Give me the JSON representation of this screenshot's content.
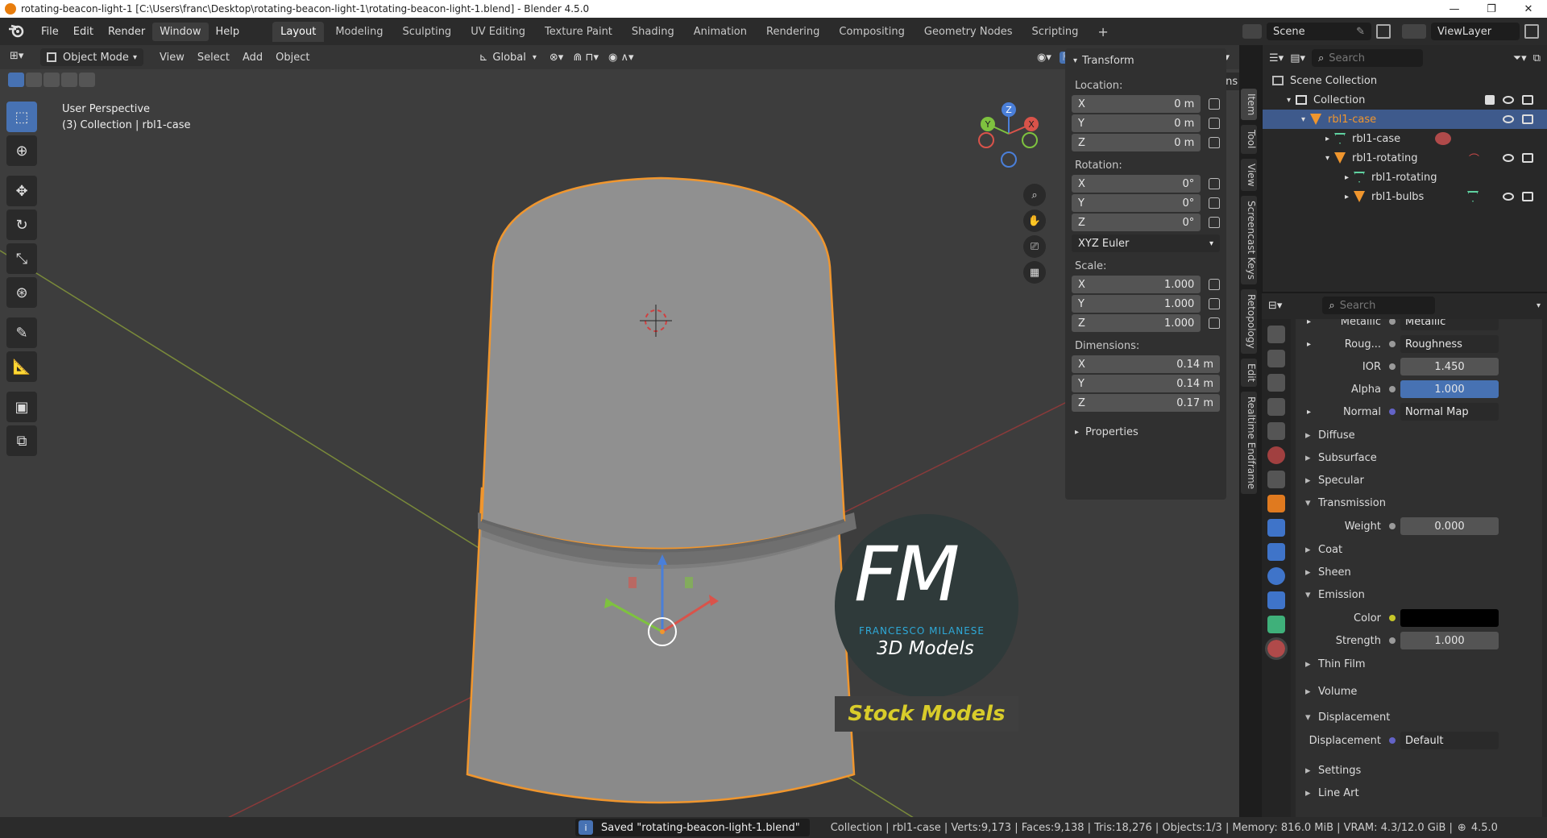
{
  "titlebar": {
    "text": "rotating-beacon-light-1 [C:\\Users\\franc\\Desktop\\rotating-beacon-light-1\\rotating-beacon-light-1.blend] - Blender 4.5.0",
    "minimize": "—",
    "restore": "❐",
    "close": "✕"
  },
  "menu": {
    "file": "File",
    "edit": "Edit",
    "render": "Render",
    "window": "Window",
    "help": "Help"
  },
  "workspaces": [
    "Layout",
    "Modeling",
    "Sculpting",
    "UV Editing",
    "Texture Paint",
    "Shading",
    "Animation",
    "Rendering",
    "Compositing",
    "Geometry Nodes",
    "Scripting"
  ],
  "scene": {
    "name": "Scene",
    "viewlayer": "ViewLayer"
  },
  "viewport": {
    "mode": "Object Mode",
    "menus": [
      "View",
      "Select",
      "Add",
      "Object"
    ],
    "orientation": "Global",
    "options": "Options",
    "overlay_title": "User Perspective",
    "overlay_subtitle": "(3) Collection | rbl1-case",
    "gizmo_x": "X",
    "gizmo_y": "Y",
    "gizmo_z": "Z"
  },
  "npanel": {
    "transform": "Transform",
    "location_label": "Location:",
    "location": [
      {
        "axis": "X",
        "val": "0 m"
      },
      {
        "axis": "Y",
        "val": "0 m"
      },
      {
        "axis": "Z",
        "val": "0 m"
      }
    ],
    "rotation_label": "Rotation:",
    "rotation": [
      {
        "axis": "X",
        "val": "0°"
      },
      {
        "axis": "Y",
        "val": "0°"
      },
      {
        "axis": "Z",
        "val": "0°"
      }
    ],
    "rotation_mode": "XYZ Euler",
    "scale_label": "Scale:",
    "scale": [
      {
        "axis": "X",
        "val": "1.000"
      },
      {
        "axis": "Y",
        "val": "1.000"
      },
      {
        "axis": "Z",
        "val": "1.000"
      }
    ],
    "dimensions_label": "Dimensions:",
    "dimensions": [
      {
        "axis": "X",
        "val": "0.14 m"
      },
      {
        "axis": "Y",
        "val": "0.14 m"
      },
      {
        "axis": "Z",
        "val": "0.17 m"
      }
    ],
    "properties": "Properties"
  },
  "sidetabs": [
    "Item",
    "Tool",
    "View",
    "Screencast Keys",
    "Retopology",
    "Edit",
    "Realtime Endframe"
  ],
  "outliner": {
    "search_placeholder": "Search",
    "scene_collection": "Scene Collection",
    "collection": "Collection",
    "items": [
      "rbl1-case",
      "rbl1-case",
      "rbl1-rotating",
      "rbl1-rotating",
      "rbl1-bulbs"
    ]
  },
  "properties": {
    "search_placeholder": "Search",
    "metallic_label": "Metallic",
    "metallic_value": "Metallic",
    "roughness_label": "Roug...",
    "roughness_value": "Roughness",
    "ior_label": "IOR",
    "ior_value": "1.450",
    "alpha_label": "Alpha",
    "alpha_value": "1.000",
    "normal_label": "Normal",
    "normal_value": "Normal Map",
    "diffuse": "Diffuse",
    "subsurface": "Subsurface",
    "specular": "Specular",
    "transmission": "Transmission",
    "weight_label": "Weight",
    "weight_value": "0.000",
    "coat": "Coat",
    "sheen": "Sheen",
    "emission": "Emission",
    "color_label": "Color",
    "strength_label": "Strength",
    "strength_value": "1.000",
    "thin_film": "Thin Film",
    "volume": "Volume",
    "displacement_section": "Displacement",
    "displacement_label": "Displacement",
    "displacement_value": "Default",
    "settings": "Settings",
    "line_art": "Line Art"
  },
  "watermark": {
    "logo": "FM",
    "name": "FRANCESCO MILANESE",
    "sub": "3D Models",
    "banner": "Stock Models"
  },
  "status": {
    "saved": "Saved \"rotating-beacon-light-1.blend\"",
    "stats": "Collection | rbl1-case | Verts:9,173 | Faces:9,138 | Tris:18,276 | Objects:1/3 | Memory: 816.0 MiB | VRAM: 4.3/12.0 GiB |",
    "version": "4.5.0"
  },
  "colors": {
    "accent": "#4772b3",
    "selection_orange": "#f0962e",
    "header": "#2b2b2b",
    "viewport": "#3d3d3d"
  }
}
